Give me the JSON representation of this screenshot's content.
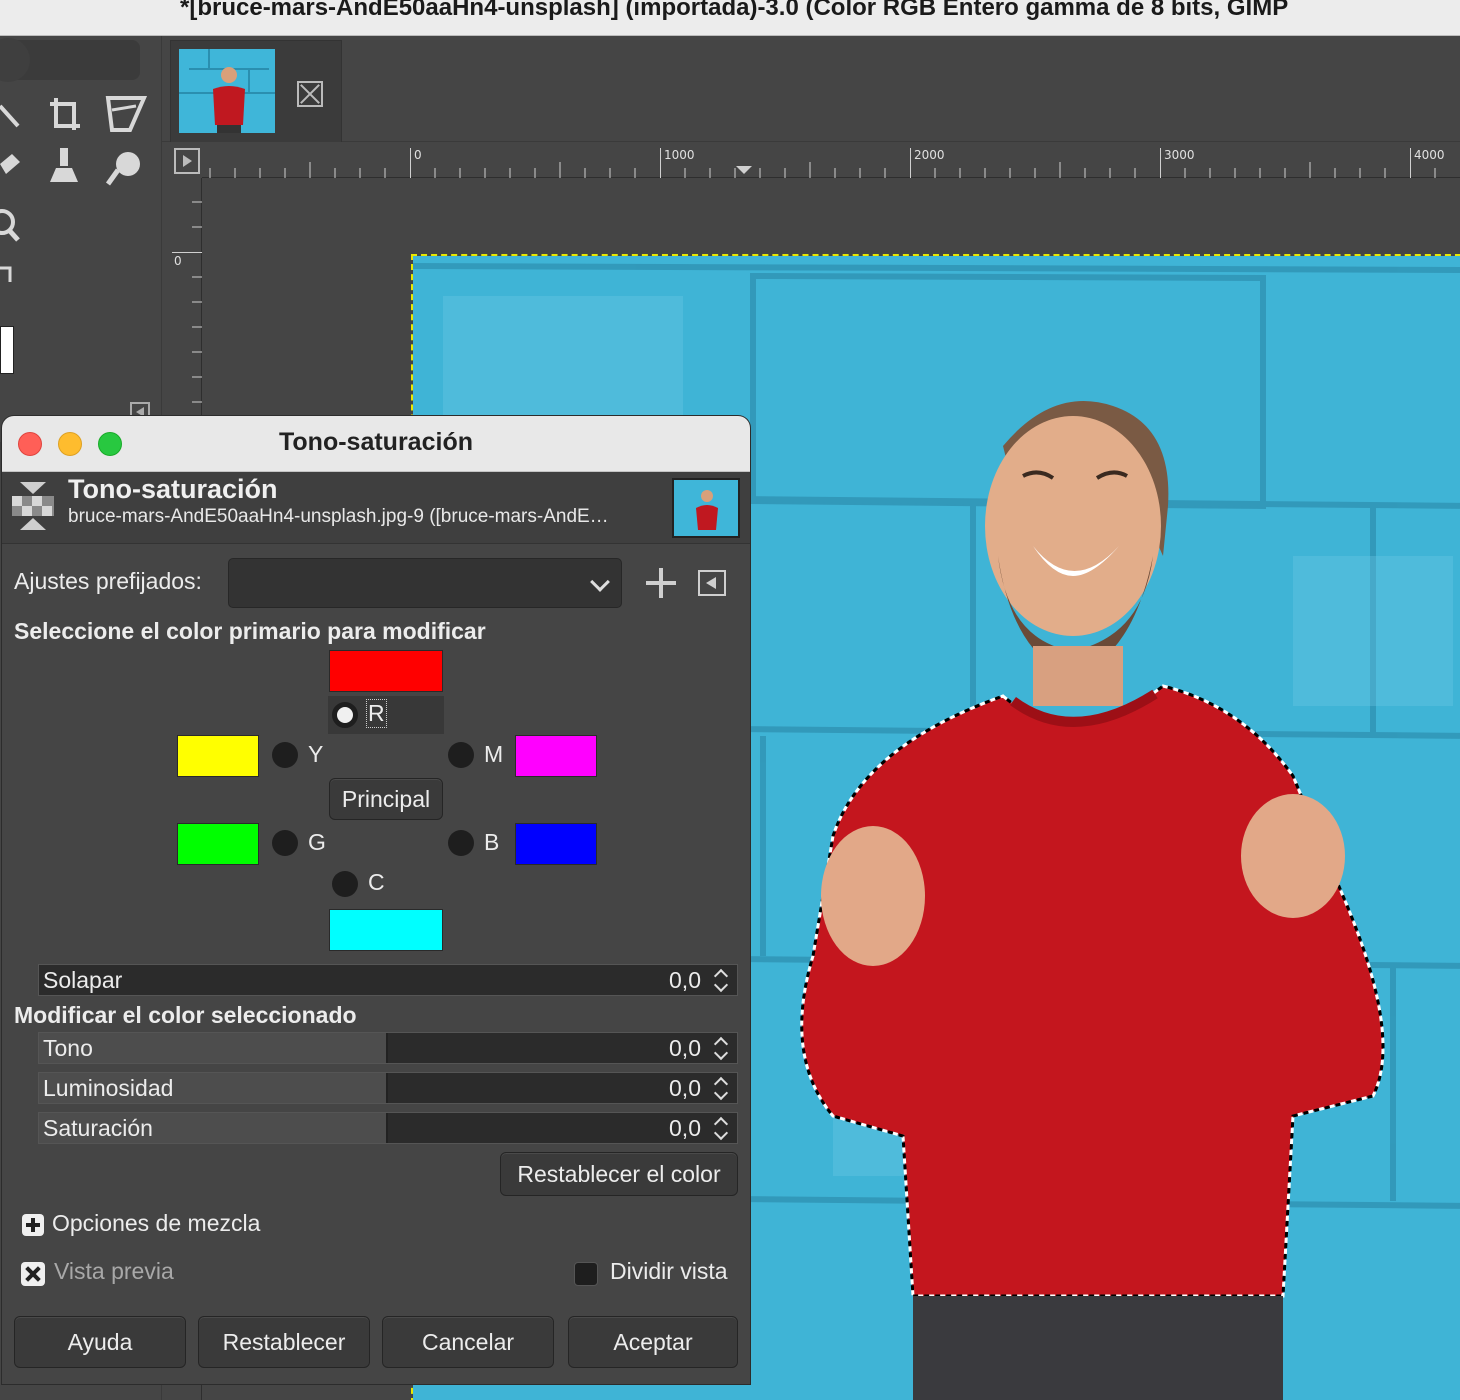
{
  "window": {
    "title": "*[bruce-mars-AndE50aaHn4-unsplash] (importada)-3.0 (Color RGB Entero gamma de 8 bits, GIMP"
  },
  "toolbox": {
    "tools": [
      "paths-icon",
      "crop-icon",
      "transform-icon",
      "paint-icon",
      "clone-icon",
      "smudge-icon",
      "zoom-icon"
    ]
  },
  "image_tab": {
    "thumbnail": "image-thumbnail"
  },
  "rulers": {
    "horizontal": [
      "0",
      "1000",
      "2000",
      "3000",
      "4000"
    ],
    "vertical": [
      "0"
    ]
  },
  "dialog": {
    "window_title": "Tono-saturación",
    "header": {
      "title": "Tono-saturación",
      "subtitle": "bruce-mars-AndE50aaHn4-unsplash.jpg-9 ([bruce-mars-AndE…"
    },
    "presets": {
      "label": "Ajustes prefijados:",
      "value": ""
    },
    "primary_section": "Seleccione el color primario para modificar",
    "primaries": {
      "R": {
        "label": "R",
        "color": "#ff0000",
        "selected": true
      },
      "Y": {
        "label": "Y",
        "color": "#ffff00",
        "selected": false
      },
      "M": {
        "label": "M",
        "color": "#ff00ff",
        "selected": false
      },
      "G": {
        "label": "G",
        "color": "#00ff00",
        "selected": false
      },
      "B": {
        "label": "B",
        "color": "#0000ff",
        "selected": false
      },
      "C": {
        "label": "C",
        "color": "#00ffff",
        "selected": false
      }
    },
    "master_button": "Principal",
    "overlap": {
      "label": "Solapar",
      "value": "0,0"
    },
    "modify_section": "Modificar el color seleccionado",
    "sliders": [
      {
        "label": "Tono",
        "value": "0,0",
        "fraction": 0.5
      },
      {
        "label": "Luminosidad",
        "value": "0,0",
        "fraction": 0.5
      },
      {
        "label": "Saturación",
        "value": "0,0",
        "fraction": 0.5
      }
    ],
    "reset_color_button": "Restablecer el color",
    "blend_options": "Opciones de mezcla",
    "preview": {
      "label": "Vista previa",
      "checked": true
    },
    "split_view": {
      "label": "Dividir vista",
      "checked": false
    },
    "buttons": {
      "help": "Ayuda",
      "reset": "Restablecer",
      "cancel": "Cancelar",
      "ok": "Aceptar"
    }
  }
}
